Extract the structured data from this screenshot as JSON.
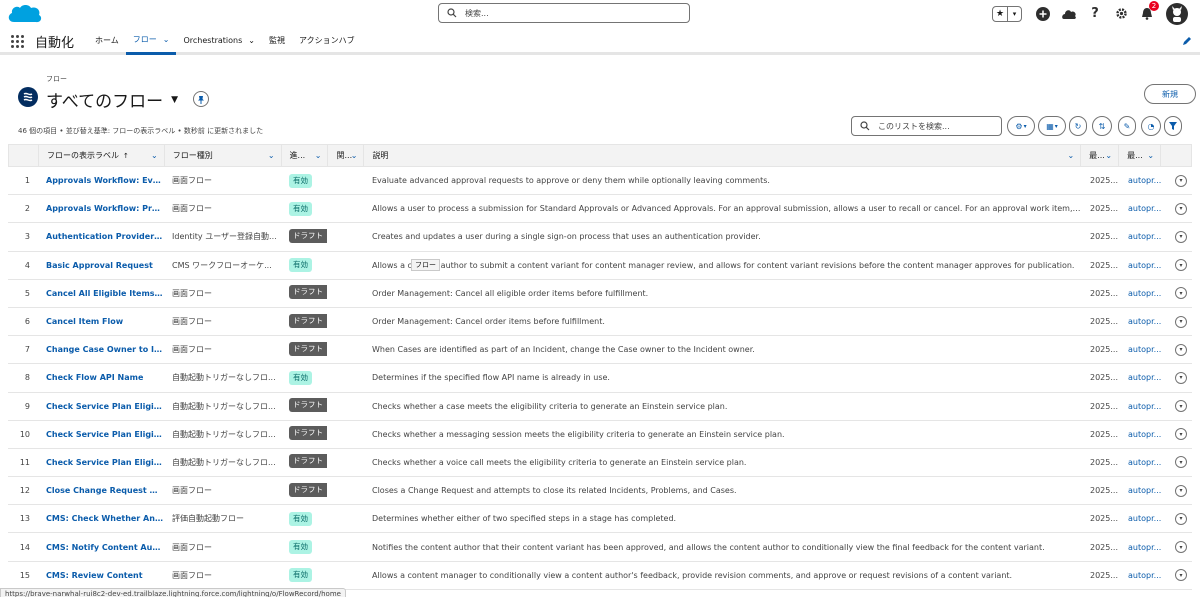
{
  "header": {
    "search_placeholder": "検索...",
    "notification_count": "2"
  },
  "nav": {
    "app_name": "自動化",
    "tabs": [
      {
        "label": "ホーム",
        "has_menu": false,
        "active": false
      },
      {
        "label": "フロー",
        "has_menu": true,
        "active": true
      },
      {
        "label": "Orchestrations",
        "has_menu": true,
        "active": false
      },
      {
        "label": "監視",
        "has_menu": false,
        "active": false
      },
      {
        "label": "アクションハブ",
        "has_menu": false,
        "active": false
      }
    ]
  },
  "list_header": {
    "object_label": "フロー",
    "title": "すべてのフロー",
    "new_button": "新規",
    "meta": "46 個の項目 • 並び替え基準: フローの表示ラベル • 数秒前 に更新されました",
    "search_placeholder": "このリストを検索..."
  },
  "columns": {
    "label": "フローの表示ラベル",
    "type": "フロー種別",
    "status": "進...",
    "related": "関...",
    "description": "説明",
    "date": "最...",
    "user": "最..."
  },
  "rows": [
    {
      "num": "1",
      "label": "Approvals Workflow: Evalua...",
      "type": "画面フロー",
      "status": "有効",
      "status_kind": "active",
      "description": "Evaluate advanced approval requests to approve or deny them while optionally leaving comments.",
      "date": "2025...",
      "user": "autopr..."
    },
    {
      "num": "2",
      "label": "Approvals Workflow: Proces...",
      "type": "画面フロー",
      "status": "有効",
      "status_kind": "active",
      "description": "Allows a user to process a submission for Standard Approvals or Advanced Approvals. For an approval submission, allows a user to recall or cancel. For an approval work item, allows a ...",
      "date": "2025...",
      "user": "autopr..."
    },
    {
      "num": "3",
      "label": "Authentication Provider Use...",
      "type": "Identity ユーザー登録自動...",
      "status": "ドラフト",
      "status_kind": "draft",
      "description": "Creates and updates a user during a single sign-on process that uses an authentication provider.",
      "date": "2025...",
      "user": "autopr..."
    },
    {
      "num": "4",
      "label": "Basic Approval Request",
      "type": "CMS ワークフローオーケ...",
      "status": "有効",
      "status_kind": "active",
      "description": "Allows a content author to submit a content variant for content manager review, and allows for content variant revisions before the content manager approves for publication.",
      "date": "2025...",
      "user": "autopr..."
    },
    {
      "num": "5",
      "label": "Cancel All Eligible Items Flow",
      "type": "画面フロー",
      "status": "ドラフト",
      "status_kind": "draft",
      "description": "Order Management: Cancel all eligible order items before fulfillment.",
      "date": "2025...",
      "user": "autopr..."
    },
    {
      "num": "6",
      "label": "Cancel Item Flow",
      "type": "画面フロー",
      "status": "ドラフト",
      "status_kind": "draft",
      "description": "Order Management: Cancel order items before fulfillment.",
      "date": "2025...",
      "user": "autopr..."
    },
    {
      "num": "7",
      "label": "Change Case Owner to Inci...",
      "type": "画面フロー",
      "status": "ドラフト",
      "status_kind": "draft",
      "description": "When Cases are identified as part of an Incident, change the Case owner to the Incident owner.",
      "date": "2025...",
      "user": "autopr..."
    },
    {
      "num": "8",
      "label": "Check Flow API Name",
      "type": "自動起動トリガーなしフロ...",
      "status": "有効",
      "status_kind": "active",
      "description": "Determines if the specified flow API name is already in use.",
      "date": "2025...",
      "user": "autopr..."
    },
    {
      "num": "9",
      "label": "Check Service Plan Eligibility",
      "type": "自動起動トリガーなしフロ...",
      "status": "ドラフト",
      "status_kind": "draft",
      "description": "Checks whether a case meets the eligibility criteria to generate an Einstein service plan.",
      "date": "2025...",
      "user": "autopr..."
    },
    {
      "num": "10",
      "label": "Check Service Plan Eligibilit...",
      "type": "自動起動トリガーなしフロ...",
      "status": "ドラフト",
      "status_kind": "draft",
      "description": "Checks whether a messaging session meets the eligibility criteria to generate an Einstein service plan.",
      "date": "2025...",
      "user": "autopr..."
    },
    {
      "num": "11",
      "label": "Check Service Plan Eligibilit...",
      "type": "自動起動トリガーなしフロ...",
      "status": "ドラフト",
      "status_kind": "draft",
      "description": "Checks whether a voice call meets the eligibility criteria to generate an Einstein service plan.",
      "date": "2025...",
      "user": "autopr..."
    },
    {
      "num": "12",
      "label": "Close Change Request & Re...",
      "type": "画面フロー",
      "status": "ドラフト",
      "status_kind": "draft",
      "description": "Closes a Change Request and attempts to close its related Incidents, Problems, and Cases.",
      "date": "2025...",
      "user": "autopr..."
    },
    {
      "num": "13",
      "label": "CMS: Check Whether Any S...",
      "type": "評価自動起動フロー",
      "status": "有効",
      "status_kind": "active",
      "description": "Determines whether either of two specified steps in a stage has completed.",
      "date": "2025...",
      "user": "autopr..."
    },
    {
      "num": "14",
      "label": "CMS: Notify Content Author",
      "type": "画面フロー",
      "status": "有効",
      "status_kind": "active",
      "description": "Notifies the content author that their content variant has been approved, and allows the content author to conditionally view the final feedback for the content variant.",
      "date": "2025...",
      "user": "autopr..."
    },
    {
      "num": "15",
      "label": "CMS: Review Content",
      "type": "画面フロー",
      "status": "有効",
      "status_kind": "active",
      "description": "Allows a content manager to conditionally view a content author's feedback, provide revision comments, and approve or request revisions of a content variant.",
      "date": "2025...",
      "user": "autopr..."
    }
  ],
  "tooltip": "フロー",
  "status_url": "https://brave-narwhal-rui8c2-dev-ed.trailblaze.lightning.force.com/lightning/o/FlowRecord/home",
  "colors": {
    "brand": "#0b5cab",
    "active_pill": "#acf3e4",
    "draft_pill": "#5c5c5c",
    "salesforce_cloud": "#00a1e0"
  }
}
